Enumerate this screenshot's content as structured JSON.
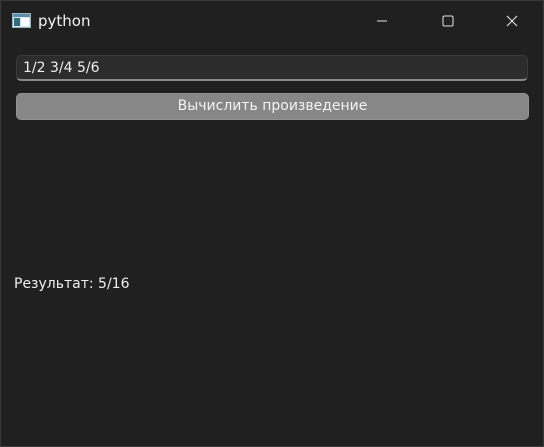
{
  "window": {
    "title": "python",
    "icons": {
      "app": "app-window-icon",
      "minimize": "minimize-icon",
      "maximize": "maximize-icon",
      "close": "close-icon"
    }
  },
  "form": {
    "input_value": "1/2 3/4 5/6",
    "button_label": "Вычислить произведение",
    "result_text": "Результат: 5/16"
  },
  "colors": {
    "background": "#202020",
    "input_background": "#2c2c2c",
    "button_background": "#878787",
    "text": "#f0f0f0"
  }
}
